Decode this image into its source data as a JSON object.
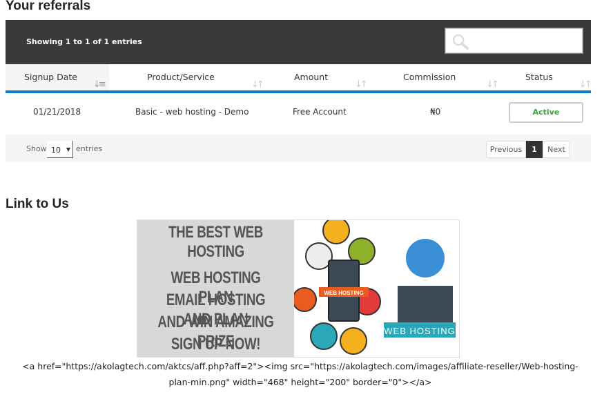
{
  "referrals": {
    "title": "Your referrals",
    "showing": "Showing 1 to 1 of 1 entries",
    "search_placeholder": "",
    "columns": [
      "Signup Date",
      "Product/Service",
      "Amount",
      "Commission",
      "Status"
    ],
    "rows": [
      {
        "date": "01/21/2018",
        "product": "Basic - web hosting - Demo",
        "amount": "Free Account",
        "commission": "₦0",
        "status": "Active"
      }
    ],
    "show_label": "Show",
    "page_size": "10",
    "entries_label": "entries",
    "pagination": {
      "previous": "Previous",
      "current": "1",
      "next": "Next"
    },
    "colors": {
      "header_bg": "#3a3a3a",
      "accent": "#0a7ac6",
      "active": "#3aa43a"
    }
  },
  "link": {
    "title": "Link to Us",
    "banner": {
      "line1": "THE BEST WEB HOSTING",
      "line2": "WEB HOSTING PLAN",
      "line3": "EMAIL HOSTING AND PLAN",
      "line4": "AND WIN AMAZING PRIZE",
      "line5": "SIGN UP NOW!",
      "ribbon1": "WEB HOSTING",
      "ribbon2": "WEB HOSTING"
    },
    "code": "<a href=\"https://akolagtech.com/aktcs/aff.php?aff=2\"><img src=\"https://akolagtech.com/images/affiliate-reseller/Web-hosting-plan-min.png\" width=\"468\" height=\"200\" border=\"0\"></a>"
  }
}
